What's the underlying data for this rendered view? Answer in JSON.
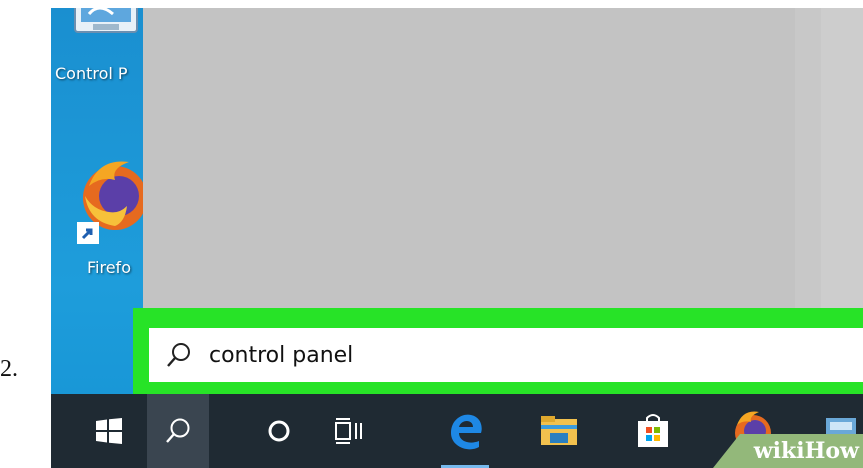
{
  "step": {
    "number": "2."
  },
  "desktop": {
    "icons": [
      {
        "label": "Control P",
        "icon": "control-panel-icon"
      },
      {
        "label": "Firefo",
        "icon": "firefox-icon"
      }
    ]
  },
  "search": {
    "query": "control panel",
    "icon": "search-icon",
    "highlight_color": "#27e327"
  },
  "taskbar": {
    "items": [
      {
        "name": "start",
        "icon": "windows-logo-icon"
      },
      {
        "name": "search",
        "icon": "search-icon",
        "active": true
      },
      {
        "name": "cortana",
        "icon": "cortana-circle-icon"
      },
      {
        "name": "task-view",
        "icon": "task-view-icon"
      },
      {
        "name": "edge",
        "icon": "edge-icon"
      },
      {
        "name": "file-explorer",
        "icon": "folder-icon"
      },
      {
        "name": "store",
        "icon": "store-bag-icon"
      },
      {
        "name": "firefox",
        "icon": "firefox-icon"
      }
    ]
  },
  "watermark": {
    "wiki": "wiki",
    "how": "How"
  },
  "colors": {
    "desktop": "#1b9ad6",
    "taskbar": "#1f2a33",
    "start_panel": "#c3c3c3"
  }
}
